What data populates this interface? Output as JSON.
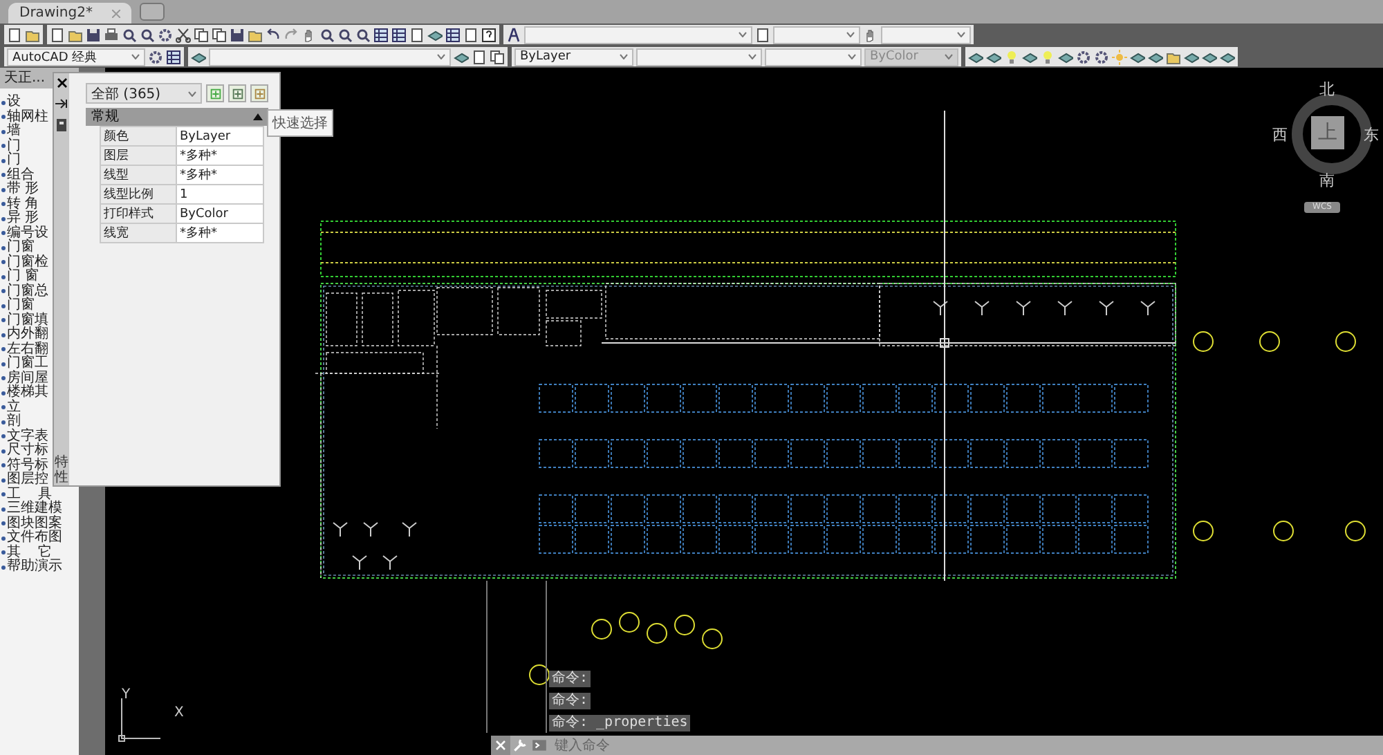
{
  "tabs": [
    {
      "label": "Drawing2*",
      "selected": true
    }
  ],
  "toolbar": {
    "workspace": "AutoCAD 经典",
    "linetype": "ByLayer",
    "plot_style": "ByColor"
  },
  "tianzheng_menu": {
    "title": "天正...",
    "items": [
      "设",
      "轴网柱",
      "墙",
      "门",
      "门",
      "组合",
      "带 形",
      "转 角",
      "异 形",
      "编号设",
      "门窗",
      "门窗检",
      "门 窗",
      "门窗总",
      "门窗",
      "门窗填",
      "内外翻",
      "左右翻",
      "门窗工",
      "房间屋",
      "楼梯其",
      "立",
      "剖",
      "文字表",
      "尺寸标",
      "符号标",
      "图层控",
      "工    具",
      "三维建模",
      "图块图案",
      "文件布图",
      "其    它",
      "帮助演示"
    ]
  },
  "properties": {
    "side_label": "特性",
    "selection": "全部 (365)",
    "tooltip": "快速选择",
    "section": {
      "title": "常规",
      "expanded": true
    },
    "rows": [
      {
        "name": "颜色",
        "value": "ByLayer"
      },
      {
        "name": "图层",
        "value": "*多种*"
      },
      {
        "name": "线型",
        "value": "*多种*"
      },
      {
        "name": "线型比例",
        "value": "1"
      },
      {
        "name": "打印样式",
        "value": "ByColor"
      },
      {
        "name": "线宽",
        "value": "*多种*"
      }
    ]
  },
  "compass": {
    "north": "北",
    "west": "西",
    "east": "东",
    "south": "南",
    "center": "上",
    "wcs": "WCS"
  },
  "ucs": {
    "x": "X",
    "y": "Y"
  },
  "command_history": [
    "命令:",
    "命令:",
    "命令: _properties"
  ],
  "command_input": {
    "placeholder": "键入命令"
  }
}
